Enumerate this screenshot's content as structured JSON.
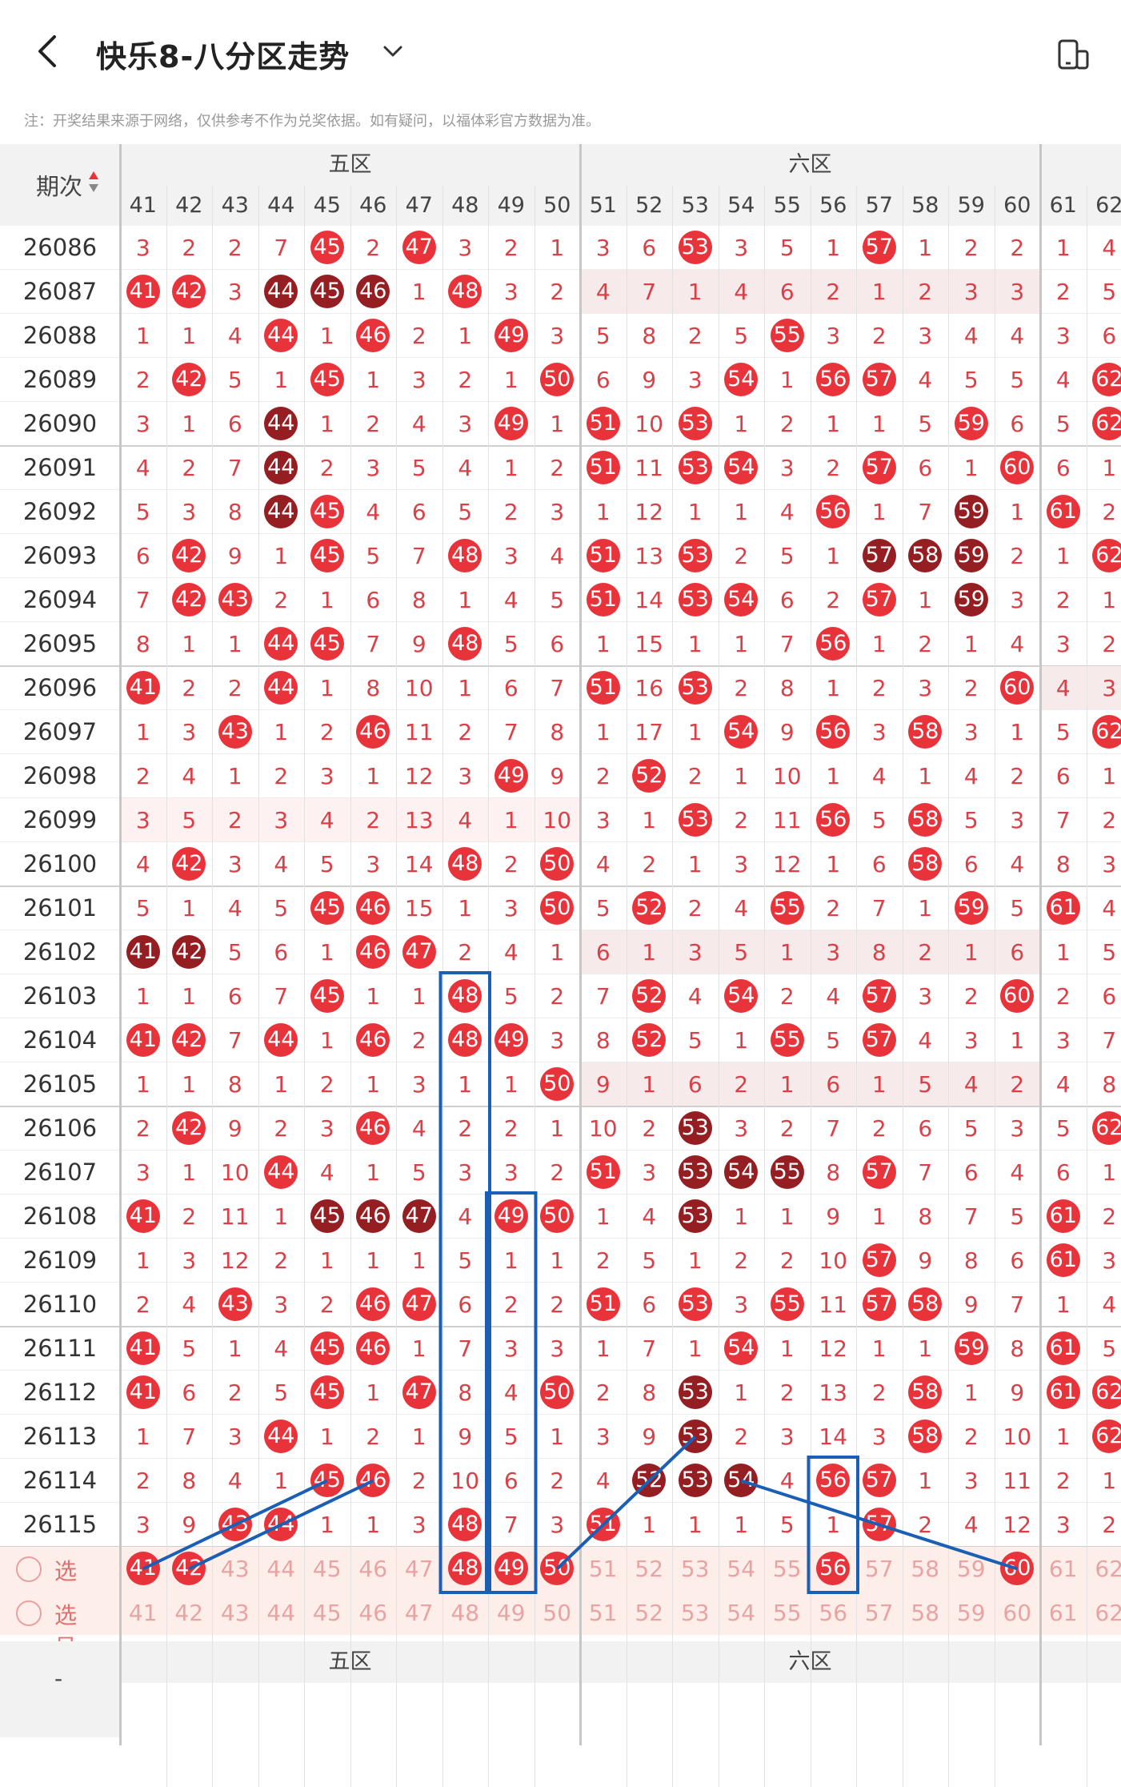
{
  "header": {
    "title": "快乐8-八分区走势"
  },
  "note": "注：开奖结果来源于网络，仅供参考不作为兑奖依据。如有疑问，以福体彩官方数据为准。",
  "table": {
    "issue_header": "期次",
    "zones": [
      "五区",
      "六区"
    ],
    "columns": [
      "41",
      "42",
      "43",
      "44",
      "45",
      "46",
      "47",
      "48",
      "49",
      "50",
      "51",
      "52",
      "53",
      "54",
      "55",
      "56",
      "57",
      "58",
      "59",
      "60",
      "61",
      "62"
    ],
    "rows": [
      {
        "issue": "26086",
        "cells": [
          "3",
          "2",
          "2",
          "7",
          "45",
          "2",
          "47",
          "3",
          "2",
          "1",
          "3",
          "6",
          "53",
          "3",
          "5",
          "1",
          "57",
          "1",
          "2",
          "2",
          "1",
          "4"
        ]
      },
      {
        "issue": "26087",
        "cells": [
          "41",
          "42",
          "3",
          "44",
          "45",
          "46",
          "1",
          "48",
          "3",
          "2",
          "4",
          "7",
          "1",
          "4",
          "6",
          "2",
          "1",
          "2",
          "3",
          "3",
          "2",
          "5"
        ]
      },
      {
        "issue": "26088",
        "cells": [
          "1",
          "1",
          "4",
          "44",
          "1",
          "46",
          "2",
          "1",
          "49",
          "3",
          "5",
          "8",
          "2",
          "5",
          "55",
          "3",
          "2",
          "3",
          "4",
          "4",
          "3",
          "6"
        ]
      },
      {
        "issue": "26089",
        "cells": [
          "2",
          "42",
          "5",
          "1",
          "45",
          "1",
          "3",
          "2",
          "1",
          "50",
          "6",
          "9",
          "3",
          "54",
          "1",
          "56",
          "57",
          "4",
          "5",
          "5",
          "4",
          "62"
        ]
      },
      {
        "issue": "26090",
        "cells": [
          "3",
          "1",
          "6",
          "44",
          "1",
          "2",
          "4",
          "3",
          "49",
          "1",
          "51",
          "10",
          "53",
          "1",
          "2",
          "1",
          "1",
          "5",
          "59",
          "6",
          "5",
          "62"
        ]
      },
      {
        "issue": "26091",
        "cells": [
          "4",
          "2",
          "7",
          "44",
          "2",
          "3",
          "5",
          "4",
          "1",
          "2",
          "51",
          "11",
          "53",
          "54",
          "3",
          "2",
          "57",
          "6",
          "1",
          "60",
          "6",
          "1"
        ]
      },
      {
        "issue": "26092",
        "cells": [
          "5",
          "3",
          "8",
          "44",
          "45",
          "4",
          "6",
          "5",
          "2",
          "3",
          "1",
          "12",
          "1",
          "1",
          "4",
          "56",
          "1",
          "7",
          "59",
          "1",
          "61",
          "2"
        ]
      },
      {
        "issue": "26093",
        "cells": [
          "6",
          "42",
          "9",
          "1",
          "45",
          "5",
          "7",
          "48",
          "3",
          "4",
          "51",
          "13",
          "53",
          "2",
          "5",
          "1",
          "57",
          "58",
          "59",
          "2",
          "1",
          "62"
        ]
      },
      {
        "issue": "26094",
        "cells": [
          "7",
          "42",
          "43",
          "2",
          "1",
          "6",
          "8",
          "1",
          "4",
          "5",
          "51",
          "14",
          "53",
          "54",
          "6",
          "2",
          "57",
          "1",
          "59",
          "3",
          "2",
          "1"
        ]
      },
      {
        "issue": "26095",
        "cells": [
          "8",
          "1",
          "1",
          "44",
          "45",
          "7",
          "9",
          "48",
          "5",
          "6",
          "1",
          "15",
          "1",
          "1",
          "7",
          "56",
          "1",
          "2",
          "1",
          "4",
          "3",
          "2"
        ]
      },
      {
        "issue": "26096",
        "cells": [
          "41",
          "2",
          "2",
          "44",
          "1",
          "8",
          "10",
          "1",
          "6",
          "7",
          "51",
          "16",
          "53",
          "2",
          "8",
          "1",
          "2",
          "3",
          "2",
          "60",
          "4",
          "3"
        ]
      },
      {
        "issue": "26097",
        "cells": [
          "1",
          "3",
          "43",
          "1",
          "2",
          "46",
          "11",
          "2",
          "7",
          "8",
          "1",
          "17",
          "1",
          "54",
          "9",
          "56",
          "3",
          "58",
          "3",
          "1",
          "5",
          "62"
        ]
      },
      {
        "issue": "26098",
        "cells": [
          "2",
          "4",
          "1",
          "2",
          "3",
          "1",
          "12",
          "3",
          "49",
          "9",
          "2",
          "52",
          "2",
          "1",
          "10",
          "1",
          "4",
          "1",
          "4",
          "2",
          "6",
          "1"
        ]
      },
      {
        "issue": "26099",
        "cells": [
          "3",
          "5",
          "2",
          "3",
          "4",
          "2",
          "13",
          "4",
          "1",
          "10",
          "3",
          "1",
          "53",
          "2",
          "11",
          "56",
          "5",
          "58",
          "5",
          "3",
          "7",
          "2"
        ]
      },
      {
        "issue": "26100",
        "cells": [
          "4",
          "42",
          "3",
          "4",
          "5",
          "3",
          "14",
          "48",
          "2",
          "50",
          "4",
          "2",
          "1",
          "3",
          "12",
          "1",
          "6",
          "58",
          "6",
          "4",
          "8",
          "3"
        ]
      },
      {
        "issue": "26101",
        "cells": [
          "5",
          "1",
          "4",
          "5",
          "45",
          "46",
          "15",
          "1",
          "3",
          "50",
          "5",
          "52",
          "2",
          "4",
          "55",
          "2",
          "7",
          "1",
          "59",
          "5",
          "61",
          "4"
        ]
      },
      {
        "issue": "26102",
        "cells": [
          "41",
          "42",
          "5",
          "6",
          "1",
          "46",
          "47",
          "2",
          "4",
          "1",
          "6",
          "1",
          "3",
          "5",
          "1",
          "3",
          "8",
          "2",
          "1",
          "6",
          "1",
          "5"
        ]
      },
      {
        "issue": "26103",
        "cells": [
          "1",
          "1",
          "6",
          "7",
          "45",
          "1",
          "1",
          "48",
          "5",
          "2",
          "7",
          "52",
          "4",
          "54",
          "2",
          "4",
          "57",
          "3",
          "2",
          "60",
          "2",
          "6"
        ]
      },
      {
        "issue": "26104",
        "cells": [
          "41",
          "42",
          "7",
          "44",
          "1",
          "46",
          "2",
          "48",
          "49",
          "3",
          "8",
          "52",
          "5",
          "1",
          "55",
          "5",
          "57",
          "4",
          "3",
          "1",
          "3",
          "7"
        ]
      },
      {
        "issue": "26105",
        "cells": [
          "1",
          "1",
          "8",
          "1",
          "2",
          "1",
          "3",
          "1",
          "1",
          "50",
          "9",
          "1",
          "6",
          "2",
          "1",
          "6",
          "1",
          "5",
          "4",
          "2",
          "4",
          "8"
        ]
      },
      {
        "issue": "26106",
        "cells": [
          "2",
          "42",
          "9",
          "2",
          "3",
          "46",
          "4",
          "2",
          "2",
          "1",
          "10",
          "2",
          "53",
          "3",
          "2",
          "7",
          "2",
          "6",
          "5",
          "3",
          "5",
          "62"
        ]
      },
      {
        "issue": "26107",
        "cells": [
          "3",
          "1",
          "10",
          "44",
          "4",
          "1",
          "5",
          "3",
          "3",
          "2",
          "51",
          "3",
          "53",
          "54",
          "55",
          "8",
          "57",
          "7",
          "6",
          "4",
          "6",
          "1"
        ]
      },
      {
        "issue": "26108",
        "cells": [
          "41",
          "2",
          "11",
          "1",
          "45",
          "46",
          "47",
          "4",
          "49",
          "50",
          "1",
          "4",
          "53",
          "1",
          "1",
          "9",
          "1",
          "8",
          "7",
          "5",
          "61",
          "2"
        ]
      },
      {
        "issue": "26109",
        "cells": [
          "1",
          "3",
          "12",
          "2",
          "1",
          "1",
          "1",
          "5",
          "1",
          "1",
          "2",
          "5",
          "1",
          "2",
          "2",
          "10",
          "57",
          "9",
          "8",
          "6",
          "61",
          "3"
        ]
      },
      {
        "issue": "26110",
        "cells": [
          "2",
          "4",
          "43",
          "3",
          "2",
          "46",
          "47",
          "6",
          "2",
          "2",
          "51",
          "6",
          "53",
          "3",
          "55",
          "11",
          "57",
          "58",
          "9",
          "7",
          "1",
          "4"
        ]
      },
      {
        "issue": "26111",
        "cells": [
          "41",
          "5",
          "1",
          "4",
          "45",
          "46",
          "1",
          "7",
          "3",
          "3",
          "1",
          "7",
          "1",
          "54",
          "1",
          "12",
          "1",
          "1",
          "59",
          "8",
          "61",
          "5"
        ]
      },
      {
        "issue": "26112",
        "cells": [
          "41",
          "6",
          "2",
          "5",
          "45",
          "1",
          "47",
          "8",
          "4",
          "50",
          "2",
          "8",
          "53",
          "1",
          "2",
          "13",
          "2",
          "58",
          "1",
          "9",
          "61",
          "62"
        ]
      },
      {
        "issue": "26113",
        "cells": [
          "1",
          "7",
          "3",
          "44",
          "1",
          "2",
          "1",
          "9",
          "5",
          "1",
          "3",
          "9",
          "53",
          "2",
          "3",
          "14",
          "3",
          "58",
          "2",
          "10",
          "1",
          "62"
        ]
      },
      {
        "issue": "26114",
        "cells": [
          "2",
          "8",
          "4",
          "1",
          "45",
          "46",
          "2",
          "10",
          "6",
          "2",
          "4",
          "52",
          "53",
          "54",
          "4",
          "56",
          "57",
          "1",
          "3",
          "11",
          "2",
          "1"
        ]
      },
      {
        "issue": "26115",
        "cells": [
          "3",
          "9",
          "43",
          "44",
          "1",
          "1",
          "3",
          "48",
          "7",
          "3",
          "51",
          "1",
          "1",
          "1",
          "5",
          "1",
          "57",
          "2",
          "4",
          "12",
          "3",
          "2"
        ]
      }
    ],
    "select_label": "选号",
    "select_rows": [
      [
        "41",
        "42",
        "43",
        "44",
        "45",
        "46",
        "47",
        "48",
        "49",
        "50",
        "51",
        "52",
        "53",
        "54",
        "55",
        "56",
        "57",
        "58",
        "59",
        "60",
        "61",
        "62"
      ],
      [
        "41",
        "42",
        "43",
        "44",
        "45",
        "46",
        "47",
        "48",
        "49",
        "50",
        "51",
        "52",
        "53",
        "54",
        "55",
        "56",
        "57",
        "58",
        "59",
        "60",
        "61",
        "62"
      ]
    ],
    "selected_balls": [
      "41",
      "42",
      "48",
      "49",
      "50",
      "56",
      "60"
    ],
    "footer_zones": [
      "五区",
      "六区"
    ],
    "footer_issue_label": "-"
  },
  "colors": {
    "ball_red": "#e8333b",
    "ball_dark": "#941e22",
    "miss_text": "#d94047",
    "guide_line": "#1a5fb4"
  }
}
